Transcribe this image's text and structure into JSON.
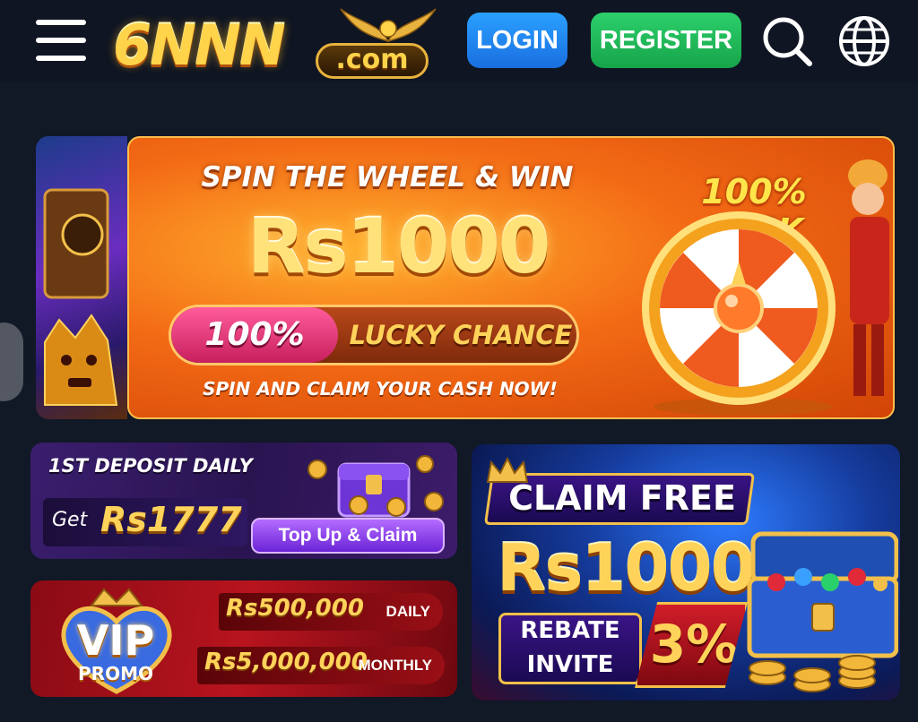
{
  "header": {
    "logo_text": "6NNN",
    "logo_suffix": ".com",
    "login_label": "LOGIN",
    "register_label": "REGISTER"
  },
  "hero": {
    "title": "SPIN THE WHEEL & WIN",
    "amount": "Rs1000",
    "lucky_percent": "100%",
    "lucky_label": "LUCKY CHANCE",
    "subtitle": "SPIN AND CLAIM YOUR CASH NOW!",
    "luck_label": "100% LUCK"
  },
  "deposit": {
    "title": "1ST DEPOSIT DAILY",
    "get_label": "Get",
    "amount": "Rs1777",
    "button_label": "Top Up & Claim"
  },
  "vip": {
    "badge_title": "VIP",
    "badge_subtitle": "PROMO",
    "daily_amount": "Rs500,000",
    "daily_label": "DAILY",
    "monthly_amount": "Rs5,000,000",
    "monthly_label": "MONTHLY"
  },
  "claim": {
    "title": "CLAIM FREE",
    "amount": "Rs1000",
    "rebate_label": "REBATE",
    "invite_label": "INVITE",
    "percent": "3%"
  },
  "colors": {
    "background": "#111826",
    "login": "#1a6fe0",
    "register": "#17a44a",
    "gold": "#ffd35a"
  },
  "icons": [
    "menu-icon",
    "search-icon",
    "globe-icon",
    "wings-icon",
    "wheel-icon",
    "chest-icon",
    "crown-icon"
  ]
}
